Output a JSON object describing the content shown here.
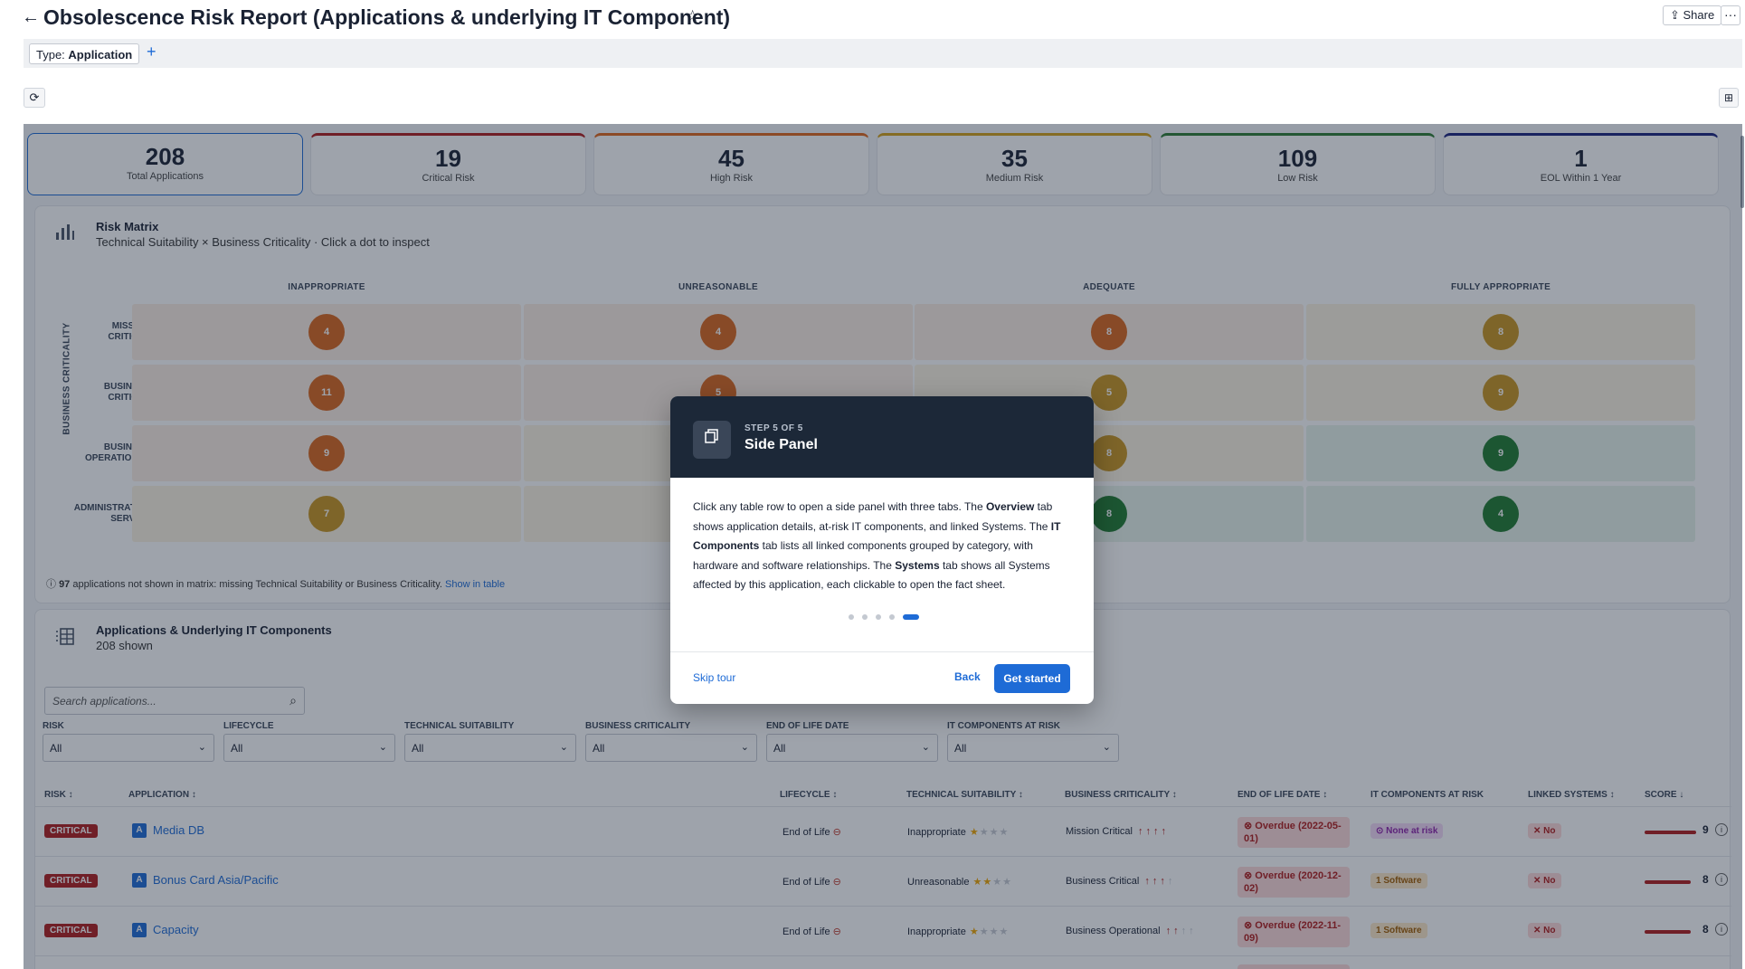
{
  "header": {
    "back_icon": "arrow-left-icon",
    "title": "Obsolescence Risk Report (Applications & underlying IT Component)",
    "favorite_icon": "star-outline-icon",
    "share_label": "Share",
    "more_label": "···"
  },
  "filters": {
    "chip_key": "Type:",
    "chip_value": "Application",
    "add_label": "+"
  },
  "toolbar": {
    "refresh_icon": "refresh-icon",
    "layout_icon": "grid-icon"
  },
  "kpis": [
    {
      "value": "208",
      "label": "Total Applications",
      "color": "#1e6bd6"
    },
    {
      "value": "19",
      "label": "Critical Risk",
      "color": "#b01c1c"
    },
    {
      "value": "45",
      "label": "High Risk",
      "color": "#e0661a"
    },
    {
      "value": "35",
      "label": "Medium Risk",
      "color": "#d4a017"
    },
    {
      "value": "109",
      "label": "Low Risk",
      "color": "#2e7d32"
    },
    {
      "value": "1",
      "label": "EOL Within 1 Year",
      "color": "#1a237e"
    }
  ],
  "matrix": {
    "title": "Risk Matrix",
    "subtitle": "Technical Suitability × Business Criticality · Click a dot to inspect",
    "y_axis_label": "BUSINESS CRITICALITY",
    "columns": [
      "INAPPROPRIATE",
      "UNREASONABLE",
      "ADEQUATE",
      "FULLY APPROPRIATE"
    ],
    "rows": [
      {
        "label_1": "MISSION",
        "label_2": "CRITICAL",
        "values": [
          "4",
          "4",
          "8",
          "8"
        ]
      },
      {
        "label_1": "BUSINESS",
        "label_2": "CRITICAL",
        "values": [
          "11",
          "5",
          "5",
          "9"
        ]
      },
      {
        "label_1": "BUSINESS",
        "label_2": "OPERATIONAL",
        "values": [
          "9",
          "",
          "8",
          "9"
        ]
      },
      {
        "label_1": "ADMINISTRATIVE",
        "label_2": "SERVICE",
        "values": [
          "7",
          "",
          "8",
          "4"
        ]
      }
    ],
    "note_count": "97",
    "note_text": " applications not shown in matrix: missing Technical Suitability or Business Criticality. ",
    "note_link": "Show in table",
    "colors": {
      "orange": "#d9661c",
      "amber": "#c99520",
      "green": "#1f7a2f"
    }
  },
  "table_section": {
    "title": "Applications & Underlying IT Components",
    "count": "208 shown",
    "search_placeholder": "Search applications...",
    "filters": [
      {
        "label": "RISK",
        "value": "All"
      },
      {
        "label": "LIFECYCLE",
        "value": "All"
      },
      {
        "label": "TECHNICAL SUITABILITY",
        "value": "All"
      },
      {
        "label": "BUSINESS CRITICALITY",
        "value": "All"
      },
      {
        "label": "END OF LIFE DATE",
        "value": "All"
      },
      {
        "label": "IT COMPONENTS AT RISK",
        "value": "All"
      }
    ],
    "columns": [
      "RISK ↕",
      "APPLICATION ↕",
      "LIFECYCLE ↕",
      "TECHNICAL SUITABILITY ↕",
      "BUSINESS CRITICALITY ↕",
      "END OF LIFE DATE ↕",
      "IT COMPONENTS AT RISK",
      "LINKED SYSTEMS ↕",
      "SCORE ↓"
    ],
    "rows": [
      {
        "risk": "CRITICAL",
        "type": "A",
        "app": "Media DB",
        "lifecycle": "End of Life",
        "ts": "Inappropriate",
        "ts_stars": 1,
        "bc": "Mission Critical",
        "bc_level": 4,
        "eol": "Overdue (2022-05-01)",
        "it": "None at risk",
        "it_kind": "none",
        "linked": "No",
        "score": "9"
      },
      {
        "risk": "CRITICAL",
        "type": "A",
        "app": "Bonus Card Asia/Pacific",
        "lifecycle": "End of Life",
        "ts": "Unreasonable",
        "ts_stars": 2,
        "bc": "Business Critical",
        "bc_level": 3,
        "eol": "Overdue (2020-12-02)",
        "it": "1 Software",
        "it_kind": "sw",
        "linked": "No",
        "score": "8"
      },
      {
        "risk": "CRITICAL",
        "type": "A",
        "app": "Capacity",
        "lifecycle": "End of Life",
        "ts": "Inappropriate",
        "ts_stars": 1,
        "bc": "Business Operational",
        "bc_level": 2,
        "eol": "Overdue (2022-11-09)",
        "it": "1 Software",
        "it_kind": "sw",
        "linked": "No",
        "score": "8"
      }
    ]
  },
  "tour": {
    "icon": "copy-panel-icon",
    "step": "STEP 5 OF 5",
    "title": "Side Panel",
    "body_1": "Click any table row to open a side panel with three tabs. The ",
    "body_b1": "Overview",
    "body_2": " tab shows application details, at-risk IT components, and linked Systems. The ",
    "body_b2": "IT Components",
    "body_3": " tab lists all linked components grouped by category, with hardware and software relationships. The ",
    "body_b3": "Systems",
    "body_4": " tab shows all Systems affected by this application, each clickable to open the fact sheet.",
    "steps_total": 5,
    "current_step": 5,
    "skip_label": "Skip tour",
    "back_label": "Back",
    "primary_label": "Get started"
  }
}
